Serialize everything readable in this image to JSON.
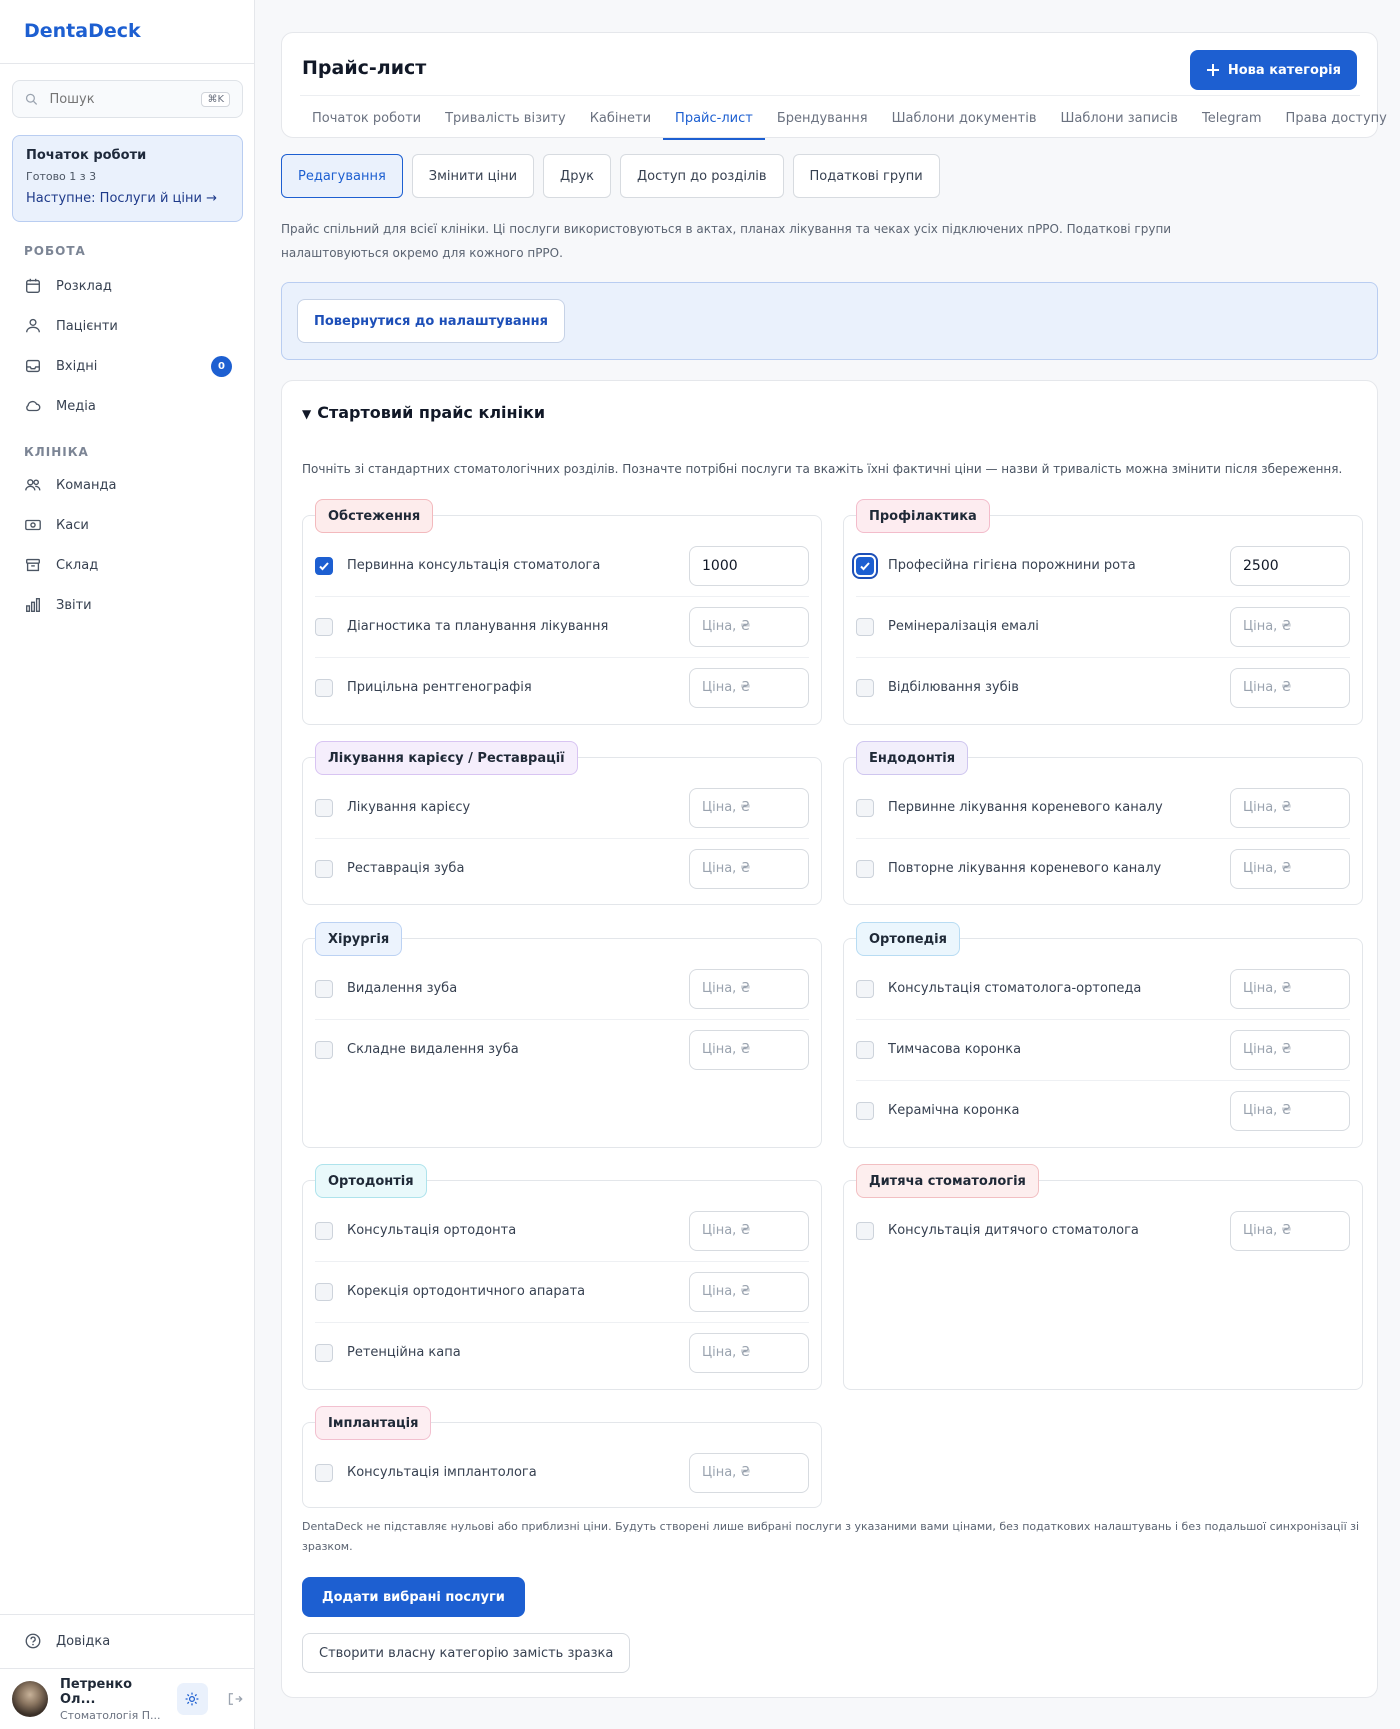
{
  "app": {
    "name": "DentaDeck"
  },
  "sidebar": {
    "search_placeholder": "Пошук",
    "search_shortcut": "⌘K",
    "onboarding": {
      "title": "Початок роботи",
      "progress": "Готово 1 з 3",
      "next": "Наступне: Послуги й ціни →"
    },
    "section_work": "РОБОТА",
    "work_items": [
      {
        "label": "Розклад",
        "icon": "calendar-icon"
      },
      {
        "label": "Пацієнти",
        "icon": "users-icon"
      },
      {
        "label": "Вхідні",
        "icon": "inbox-icon",
        "badge": "0"
      },
      {
        "label": "Медіа",
        "icon": "cloud-icon"
      }
    ],
    "section_clinic": "КЛІНІКА",
    "clinic_items": [
      {
        "label": "Команда",
        "icon": "team-icon"
      },
      {
        "label": "Каси",
        "icon": "cash-icon"
      },
      {
        "label": "Склад",
        "icon": "archive-icon"
      },
      {
        "label": "Звіти",
        "icon": "bar-chart-icon"
      }
    ],
    "help": "Довідка",
    "user": {
      "name": "Петренко Ол...",
      "role": "Стоматологія П..."
    }
  },
  "header": {
    "title": "Прайс-лист",
    "new_category": "Нова категорія",
    "tabs": [
      "Початок роботи",
      "Тривалість візиту",
      "Кабінети",
      "Прайс-лист",
      "Брендування",
      "Шаблони документів",
      "Шаблони записів",
      "Telegram",
      "Права доступу"
    ],
    "active_tab": "Прайс-лист"
  },
  "subtabs": [
    "Редагування",
    "Змінити ціни",
    "Друк",
    "Доступ до розділів",
    "Податкові групи"
  ],
  "active_subtab": "Редагування",
  "description": "Прайс спільний для всієї клініки. Ці послуги використовуються в актах, планах лікування та чеках усіх підключених пРРО. Податкові групи налаштовуються окремо для кожного пРРО.",
  "back_button": "Повернутися до налаштування",
  "starter": {
    "title": "Стартовий прайс клініки",
    "description": "Почніть зі стандартних стоматологічних розділів. Позначте потрібні послуги та вкажіть їхні фактичні ціни — назви й тривалість можна змінити після збереження.",
    "price_placeholder": "Ціна, ₴",
    "categories": [
      {
        "name": "Обстеження",
        "color": "#fdecec",
        "border": "#f3b9bd",
        "items": [
          {
            "name": "Первинна консультація стоматолога",
            "checked": true,
            "price": "1000"
          },
          {
            "name": "Діагностика та планування лікування",
            "checked": false,
            "price": ""
          },
          {
            "name": "Прицільна рентгенографія",
            "checked": false,
            "price": ""
          }
        ]
      },
      {
        "name": "Профілактика",
        "color": "#fdecf0",
        "border": "#f3bccb",
        "items": [
          {
            "name": "Професійна гігієна порожнини рота",
            "checked": true,
            "price": "2500"
          },
          {
            "name": "Ремінералізація емалі",
            "checked": false,
            "price": ""
          },
          {
            "name": "Відбілювання зубів",
            "checked": false,
            "price": ""
          }
        ]
      },
      {
        "name": "Лікування карієсу / Реставрації",
        "color": "#f5eefc",
        "border": "#d8c4f2",
        "items": [
          {
            "name": "Лікування карієсу",
            "checked": false,
            "price": ""
          },
          {
            "name": "Реставрація зуба",
            "checked": false,
            "price": ""
          }
        ]
      },
      {
        "name": "Ендодонтія",
        "color": "#f2effb",
        "border": "#cfc6ef",
        "items": [
          {
            "name": "Первинне лікування кореневого каналу",
            "checked": false,
            "price": ""
          },
          {
            "name": "Повторне лікування кореневого каналу",
            "checked": false,
            "price": ""
          }
        ]
      },
      {
        "name": "Хірургія",
        "color": "#ecf3fd",
        "border": "#bcd2f3",
        "items": [
          {
            "name": "Видалення зуба",
            "checked": false,
            "price": ""
          },
          {
            "name": "Складне видалення зуба",
            "checked": false,
            "price": ""
          }
        ]
      },
      {
        "name": "Ортопедія",
        "color": "#ebf6fd",
        "border": "#b8dcf3",
        "items": [
          {
            "name": "Консультація стоматолога-ортопеда",
            "checked": false,
            "price": ""
          },
          {
            "name": "Тимчасова коронка",
            "checked": false,
            "price": ""
          },
          {
            "name": "Керамічна коронка",
            "checked": false,
            "price": ""
          }
        ]
      },
      {
        "name": "Ортодонтія",
        "color": "#e9f9fb",
        "border": "#aee3ec",
        "items": [
          {
            "name": "Консультація ортодонта",
            "checked": false,
            "price": ""
          },
          {
            "name": "Корекція ортодонтичного апарата",
            "checked": false,
            "price": ""
          },
          {
            "name": "Ретенційна капа",
            "checked": false,
            "price": ""
          }
        ]
      },
      {
        "name": "Дитяча стоматологія",
        "color": "#fdeeee",
        "border": "#f2bfc2",
        "items": [
          {
            "name": "Консультація дитячого стоматолога",
            "checked": false,
            "price": ""
          }
        ]
      },
      {
        "name": "Імплантація",
        "color": "#fdeef2",
        "border": "#f2c0cf",
        "items": [
          {
            "name": "Консультація імплантолога",
            "checked": false,
            "price": ""
          }
        ]
      }
    ],
    "footnote": "DentaDeck не підставляє нульові або приблизні ціни. Будуть створені лише вибрані послуги з указаними вами цінами, без податкових налаштувань і без подальшої синхронізації зі зразком.",
    "add_button": "Додати вибрані послуги",
    "own_button": "Створити власну категорію замість зразка"
  }
}
